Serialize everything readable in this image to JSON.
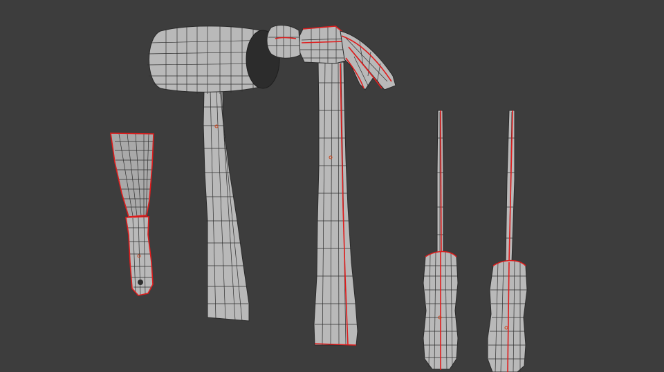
{
  "scene": {
    "background_color": "#3d3d3d",
    "mesh_color": "#b9b9b9",
    "wire_color": "#2f2f2f",
    "seam_color": "#e01c1c",
    "objects": [
      {
        "id": "putty-knife",
        "icon": "putty-knife-icon"
      },
      {
        "id": "mallet",
        "icon": "mallet-icon"
      },
      {
        "id": "claw-hammer",
        "icon": "claw-hammer-icon"
      },
      {
        "id": "screwdriver-flat",
        "icon": "screwdriver-icon"
      },
      {
        "id": "screwdriver-phillips",
        "icon": "screwdriver-icon"
      }
    ]
  }
}
